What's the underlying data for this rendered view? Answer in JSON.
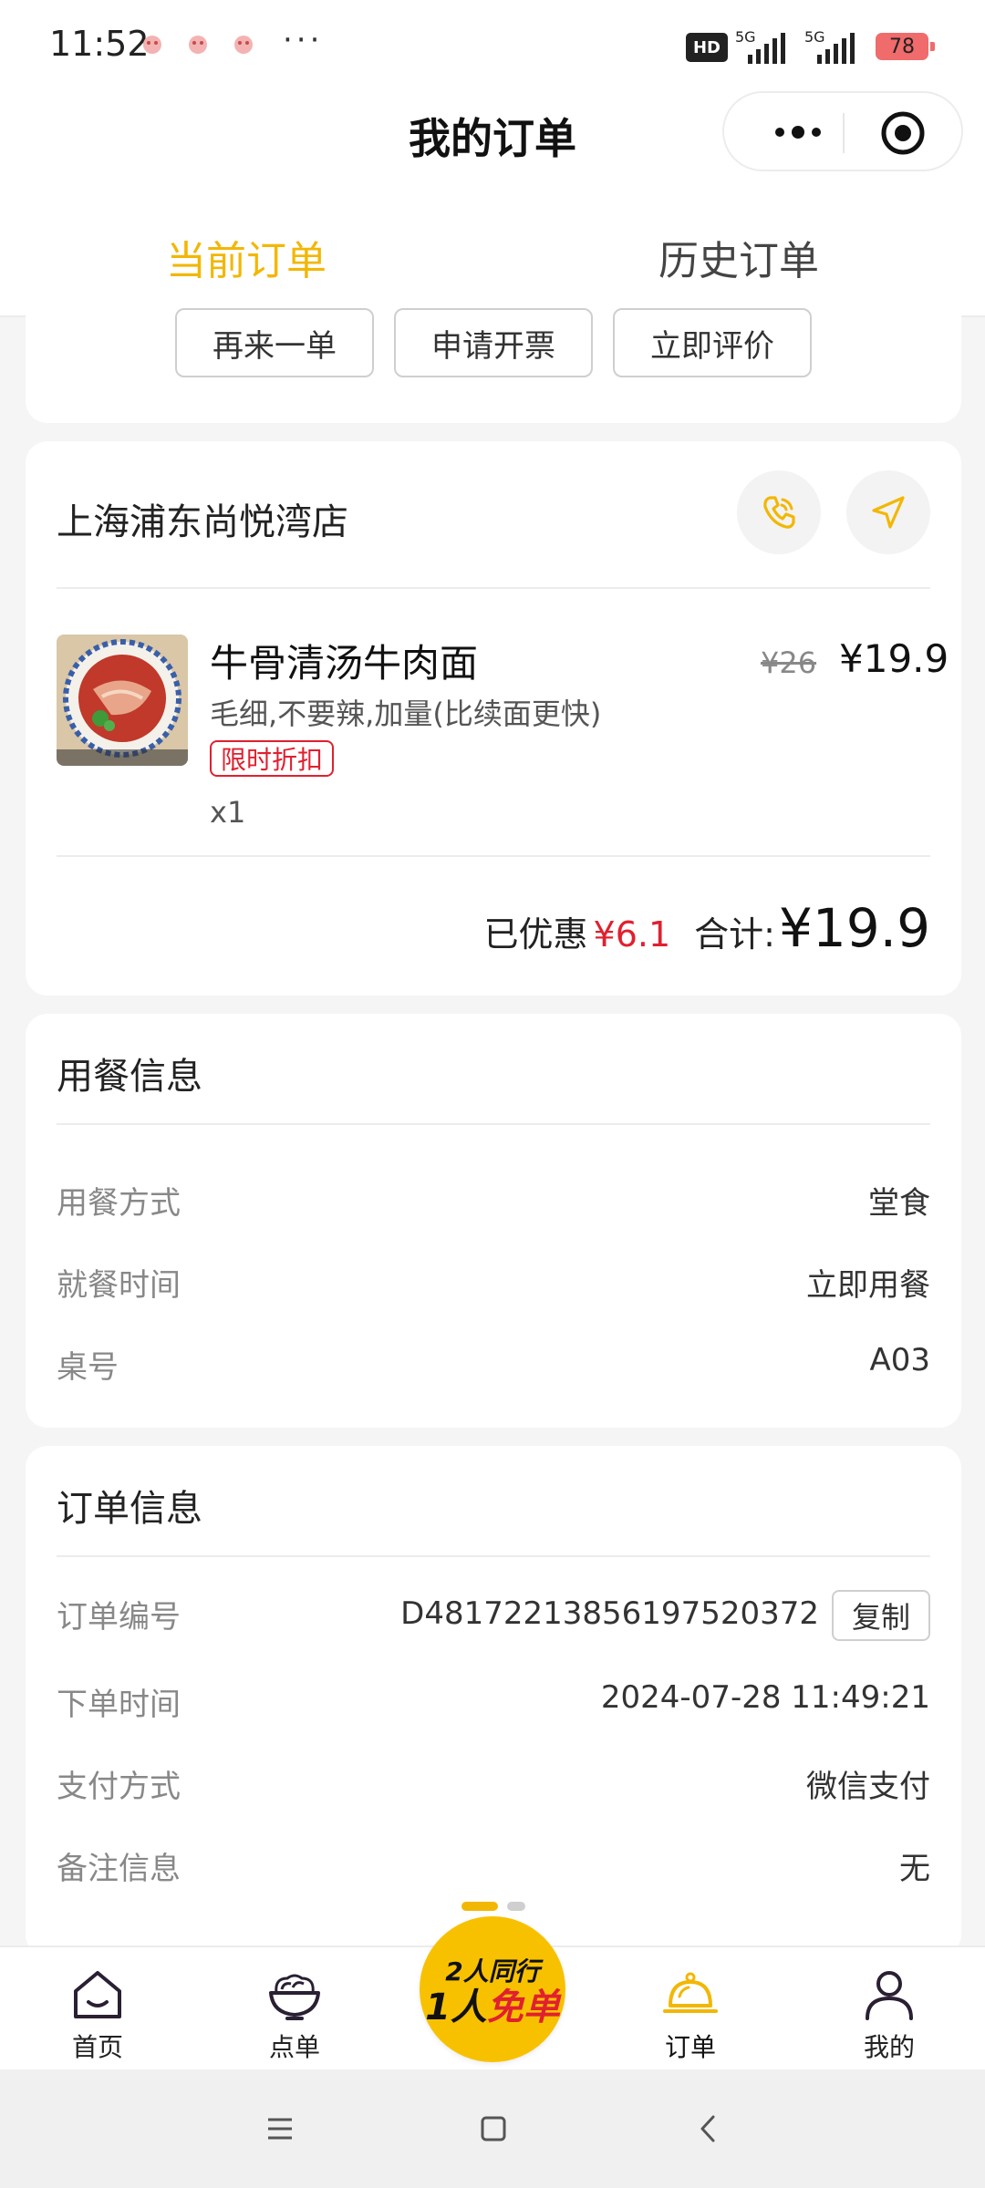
{
  "status_bar": {
    "time": "11:52",
    "dots": "···",
    "hd": "HD",
    "network_1": "5G",
    "network_2": "5G",
    "battery": "78"
  },
  "header": {
    "title": "我的订单",
    "more_icon": "more-dots-icon",
    "close_icon": "target-close-icon"
  },
  "tabs": [
    {
      "label": "当前订单",
      "active": true
    },
    {
      "label": "历史订单",
      "active": false
    }
  ],
  "actions": [
    "再来一单",
    "申请开票",
    "立即评价"
  ],
  "order": {
    "store_name": "上海浦东尚悦湾店",
    "item": {
      "name": "牛骨清汤牛肉面",
      "spec": "毛细,不要辣,加量(比续面更快)",
      "tag": "限时折扣",
      "quantity": "x1",
      "original_price": "¥26",
      "price": "¥19.9"
    },
    "discount_label": "已优惠",
    "discount_value": "¥6.1",
    "total_label": "合计:",
    "total_value": "¥19.9"
  },
  "dining": {
    "title": "用餐信息",
    "rows": [
      {
        "label": "用餐方式",
        "value": "堂食"
      },
      {
        "label": "就餐时间",
        "value": "立即用餐"
      },
      {
        "label": "桌号",
        "value": "A03"
      }
    ]
  },
  "order_info": {
    "title": "订单信息",
    "rows": [
      {
        "label": "订单编号",
        "value": "D48172213856197520372"
      },
      {
        "label": "下单时间",
        "value": "2024-07-28 11:49:21"
      },
      {
        "label": "支付方式",
        "value": "微信支付"
      },
      {
        "label": "备注信息",
        "value": "无"
      }
    ],
    "copy_label": "复制"
  },
  "bottom_nav": [
    {
      "label": "首页",
      "icon": "home-icon"
    },
    {
      "label": "点单",
      "icon": "bowl-icon"
    },
    {
      "label": "订单",
      "icon": "cloche-icon",
      "active": true
    },
    {
      "label": "我的",
      "icon": "user-icon"
    }
  ],
  "promo": {
    "line1": "2人同行",
    "line2_a": "1人",
    "line2_b": "免单"
  },
  "colors": {
    "accent": "#f2b705",
    "danger": "#e0202f",
    "promo": "#f8c100"
  }
}
